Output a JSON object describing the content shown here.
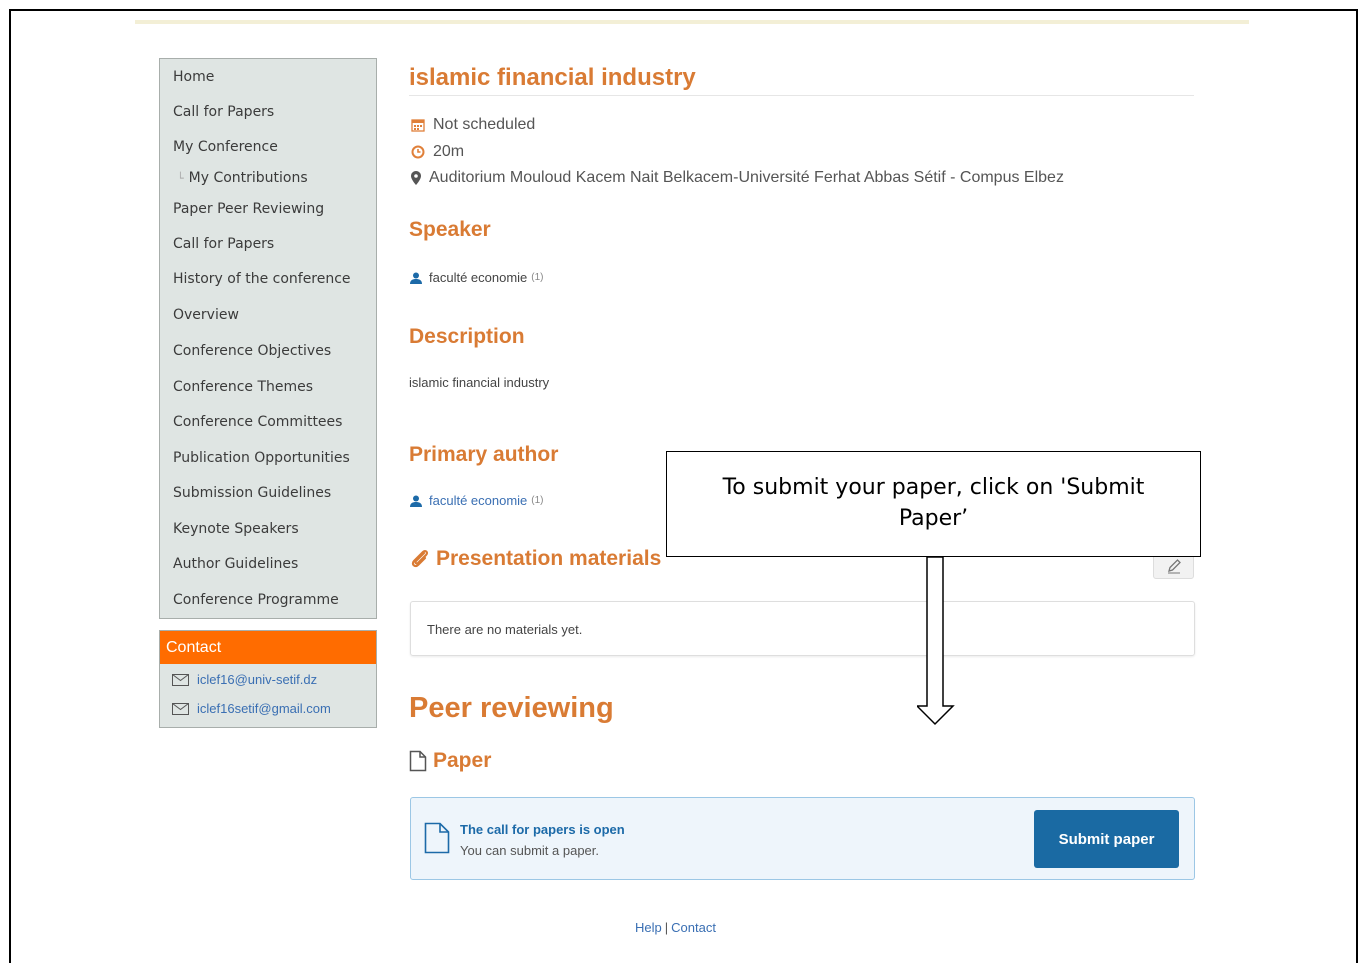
{
  "sidebar": {
    "items": [
      {
        "label": "Home"
      },
      {
        "label": "Call for Papers"
      },
      {
        "label": "My Conference"
      },
      {
        "label": "My Contributions",
        "sub": true
      },
      {
        "label": "Paper Peer Reviewing"
      },
      {
        "label": "Call for Papers"
      },
      {
        "label": "History of the conference"
      },
      {
        "label": "Overview"
      },
      {
        "label": "Conference Objectives"
      },
      {
        "label": "Conference Themes"
      },
      {
        "label": "Conference Committees"
      },
      {
        "label": "Publication Opportunities"
      },
      {
        "label": "Submission Guidelines"
      },
      {
        "label": "Keynote Speakers"
      },
      {
        "label": "Author Guidelines"
      },
      {
        "label": "Conference Programme"
      }
    ]
  },
  "contact": {
    "title": "Contact",
    "emails": [
      "iclef16@univ-setif.dz",
      "iclef16setif@gmail.com"
    ]
  },
  "contribution": {
    "title": "islamic financial industry",
    "schedule": "Not scheduled",
    "duration": "20m",
    "location": "Auditorium Mouloud Kacem Nait Belkacem-Université Ferhat Abbas Sétif - Compus Elbez",
    "speaker_heading": "Speaker",
    "speaker_name": "faculté economie",
    "speaker_count": "(1)",
    "description_heading": "Description",
    "description": "islamic financial industry",
    "primary_author_heading": "Primary author",
    "primary_author_name": "faculté economie",
    "primary_author_count": "(1)"
  },
  "materials": {
    "heading": "Presentation materials",
    "empty_text": "There are no materials yet."
  },
  "peer_review": {
    "heading": "Peer reviewing",
    "paper_heading": "Paper",
    "cfp_title": "The call for papers is open",
    "cfp_sub": "You can submit a paper.",
    "submit_label": "Submit paper"
  },
  "footer": {
    "help": "Help",
    "separator": "|",
    "contact": "Contact"
  },
  "callout": {
    "text": "To submit your paper, click on 'Submit Paper’"
  },
  "colors": {
    "accent": "#d97b34",
    "contact_header": "#ff6c00",
    "primary_button": "#1a6aa3",
    "link": "#3a6fb3"
  },
  "icons": {
    "schedule": "calendar-icon",
    "duration": "clock-icon",
    "location": "map-marker-icon",
    "person": "user-icon",
    "materials": "paperclip-icon",
    "edit": "pencil-icon",
    "paper": "file-icon",
    "mail": "envelope-icon"
  }
}
